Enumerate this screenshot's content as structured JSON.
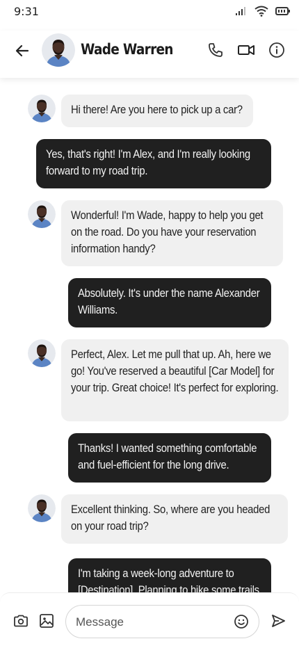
{
  "status": {
    "time": "9:31"
  },
  "contact": {
    "name": "Wade Warren"
  },
  "messages": [
    {
      "from": "contact",
      "text": "Hi there! Are you here to pick up a car?"
    },
    {
      "from": "me",
      "text": "Yes, that's right! I'm Alex, and I'm really looking forward to my road trip."
    },
    {
      "from": "contact",
      "text": "Wonderful! I'm Wade, happy to help you get on the road.  Do you have your reservation information handy?"
    },
    {
      "from": "me",
      "text": "Absolutely. It's under the name Alexander Williams."
    },
    {
      "from": "contact",
      "text": "Perfect, Alex. Let me pull that up.  Ah, here we go! You've reserved a beautiful [Car Model] for your trip.  Great choice! It's perfect for exploring."
    },
    {
      "from": "me",
      "text": "Thanks! I wanted something comfortable and fuel-efficient for the long drive."
    },
    {
      "from": "contact",
      "text": "Excellent thinking. So, where are you headed on your road trip?"
    },
    {
      "from": "me",
      "text": "I'm taking a week-long adventure to [Destination].  Planning to hike some trails"
    }
  ],
  "composer": {
    "placeholder": "Message"
  },
  "colors": {
    "outgoing_bubble": "#202020",
    "incoming_bubble": "#f0f0f0",
    "icon": "#333333"
  },
  "icons": [
    "back-arrow",
    "phone",
    "video-camera",
    "info",
    "camera",
    "image",
    "emoji",
    "send"
  ]
}
